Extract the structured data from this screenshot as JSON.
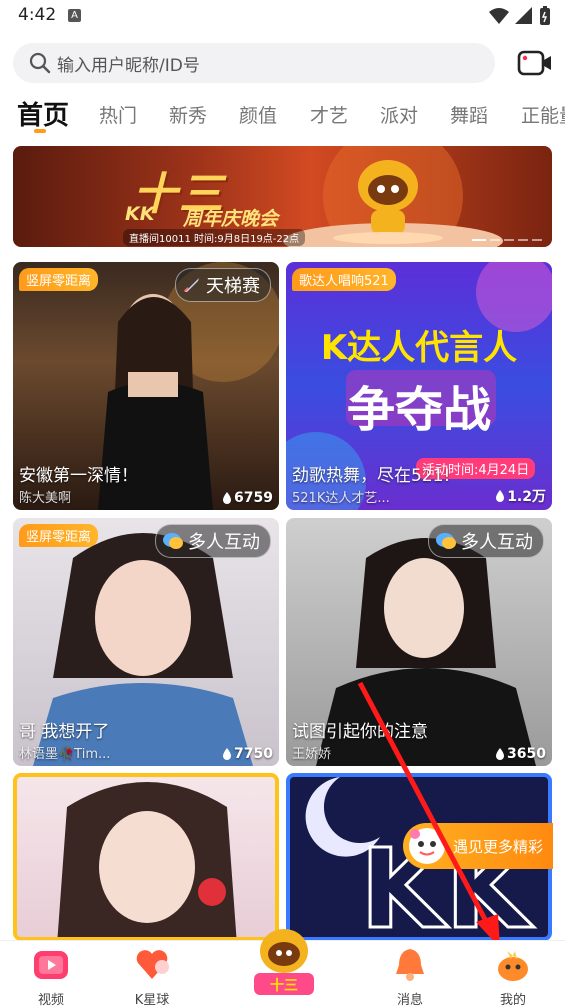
{
  "status": {
    "time": "4:42",
    "notif_letter": "A"
  },
  "search": {
    "placeholder": "输入用户昵称/ID号"
  },
  "tabs": [
    {
      "label": "首页"
    },
    {
      "label": "热门"
    },
    {
      "label": "新秀"
    },
    {
      "label": "颜值"
    },
    {
      "label": "才艺"
    },
    {
      "label": "派对"
    },
    {
      "label": "舞蹈"
    },
    {
      "label": "正能量"
    }
  ],
  "banner": {
    "title": "十三",
    "kk": "KK",
    "subtitle": "周年庆晚会",
    "info": "直播间10011  时间:9月8日19点-22点"
  },
  "cards": [
    {
      "tag": "竖屏零距离",
      "badge": "天梯赛",
      "title": "安徽第一深情！",
      "subtitle": "陈大美啊",
      "count": "6759"
    },
    {
      "tag": "歌达人唱响521",
      "promo_line1": "K达人代言人",
      "promo_line2": "争夺战",
      "promo_date": "活动时间:4月24日",
      "title": "劲歌热舞，尽在521!",
      "subtitle": "521K达人才艺...",
      "count": "1.2万"
    },
    {
      "tag": "竖屏零距离",
      "badge": "多人互动",
      "title": "哥 我想开了",
      "subtitle": "林语墨🥀Tim...",
      "count": "7750"
    },
    {
      "badge": "多人互动",
      "title": "试图引起你的注意",
      "subtitle": "王娇娇",
      "count": "3650"
    },
    {},
    {
      "overlay": "遇见更多精彩"
    }
  ],
  "nav": [
    {
      "label": "视频"
    },
    {
      "label": "K星球"
    },
    {
      "label": ""
    },
    {
      "label": "消息"
    },
    {
      "label": "我的"
    }
  ],
  "colors": {
    "accent": "#ff9c1a",
    "annotation_arrow": "#ff1a1a"
  }
}
